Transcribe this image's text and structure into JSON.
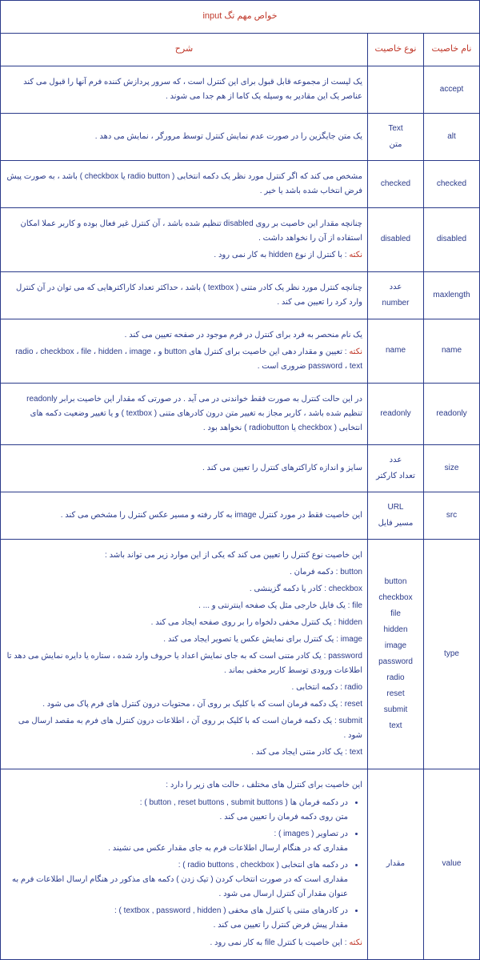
{
  "title": "خواص مهم تگ input",
  "headers": {
    "name": "نام خاصیت",
    "type": "نوع خاصیت",
    "desc": "شرح"
  },
  "rows": [
    {
      "name": "accept",
      "type": [
        ""
      ],
      "desc": "<p>یک لیست از مجموعه قابل قبول برای این کنترل است ، که سرور پردازش کننده فرم آنها را قبول می کند عناصر یک این مقادیر به وسیله یک کاما از هم جدا می شوند .</p>"
    },
    {
      "name": "alt",
      "type": [
        "Text",
        "متن"
      ],
      "desc": "<p>یک متن جایگزین را در صورت عدم نمایش کنترل توسط مرورگر ، نمایش می دهد .</p>"
    },
    {
      "name": "checked",
      "type": [
        "checked"
      ],
      "desc": "<p>مشخص می کند که اگر کنترل مورد نظر یک دکمه انتخابی ( radio button یا checkbox ) باشد ، به صورت پیش فرض انتخاب شده باشد یا خیر .</p>"
    },
    {
      "name": "disabled",
      "type": [
        "disabled"
      ],
      "desc": "<p>چنانچه مقدار این خاصیت بر روی disabled تنظیم شده باشد ، آن کنترل غیر فعال بوده و کاربر عملا امکان استفاده از آن را نخواهد داشت .</p><p><span class=\"red\">نکته</span> : با کنترل از نوع hidden به کار نمی رود .</p>"
    },
    {
      "name": "maxlength",
      "type": [
        "عدد",
        "number"
      ],
      "desc": "<p>چنانچه کنترل مورد نظر یک کادر متنی ( textbox ) باشد ، حداکثر تعداد کاراکترهایی که می توان در آن کنترل وارد کرد را تعیین می کند .</p>"
    },
    {
      "name": "name",
      "type": [
        "name"
      ],
      "desc": "<p>یک نام منحصر به فرد برای کنترل در فرم موجود در صفحه تعیین می کند .</p><p><span class=\"red\">نکته</span> : تعیین و مقدار دهی این خاصیت برای کنترل های button و radio ، checkbox ، file ، hidden ، image ، password ، text ضروری است .</p>"
    },
    {
      "name": "readonly",
      "type": [
        "readonly"
      ],
      "desc": "<p>در این حالت کنترل به صورت فقط خواندنی در می آید . در صورتی که مقدار این خاصیت برابر readonly تنظیم شده باشد ، کاربر مجاز به تغییر متن درون کادرهای متنی ( textbox ) و یا تغییر وضعیت دکمه های انتخابی ( checkbox یا radiobutton ) نخواهد بود .</p>"
    },
    {
      "name": "size",
      "type": [
        "عدد",
        "تعداد کارکتر"
      ],
      "desc": "<p>سایز و اندازه کاراکترهای کنترل را تعیین می کند .</p>"
    },
    {
      "name": "src",
      "type": [
        "URL",
        "مسیر فایل"
      ],
      "desc": "<p>این خاصیت فقط در مورد کنترل image به کار رفته و مسیر عکس کنترل را مشخص می کند .</p>"
    },
    {
      "name": "type",
      "type": [
        "button",
        "checkbox",
        "file",
        "hidden",
        "image",
        "password",
        "radio",
        "reset",
        "submit",
        "text"
      ],
      "desc": "<p>این خاصیت نوع کنترل را تعیین می کند که یکی از این موارد زیر می تواند باشد :</p><p>button : دکمه فرمان .</p><p>checkbox : کادر یا دکمه گزینشی .</p><p>file : یک فایل خارجی مثل یک صفحه اینترنتی و ... .</p><p>hidden : یک کنترل مخفی دلخواه را بر روی صفحه ایجاد می کند .</p><p>image : یک کنترل برای نمایش عکس یا تصویر ایجاد می کند .</p><p>password : یک کادر متنی است که به جای نمایش اعداد یا حروف وارد شده ، ستاره یا دایره نمایش می دهد تا اطلاعات ورودی توسط کاربر مخفی بماند .</p><p>radio : دکمه انتخابی .</p><p>reset : یک دکمه فرمان است که با کلیک بر روی آن ، محتویات درون کنترل های فرم پاک می شود .</p><p>submit : یک دکمه فرمان است که با کلیک بر روی آن ، اطلاعات درون کنترل های فرم به مقصد ارسال می شود .</p><p>text : یک کادر متنی ایجاد می کند .</p>"
    },
    {
      "name": "value",
      "type": [
        "مقدار"
      ],
      "desc": "<p>این خاصیت برای کنترل های مختلف ، حالت های زیر را دارد :</p><ul><li>در دکمه فرمان ها ( button , reset buttons , submit buttons ) :<br>متن روی دکمه فرمان را تعیین می کند .</li><li>در تصاویر ( images ) :<br>مقداری که در هنگام ارسال اطلاعات فرم به جای مقدار عکس می نشیند .</li><li>در دکمه های انتخابی ( radio buttons , checkbox ) :<br>مقداری است که در صورت انتخاب کردن ( تیک زدن ) دکمه های مذکور در هنگام ارسال اطلاعات فرم به عنوان مقدار آن کنترل ارسال می شود .</li><li>در کادرهای متنی یا کنترل های مخفی ( textbox , password , hidden ) :<br>مقدار پیش فرض کنترل را تعیین می کند .</li></ul><p><span class=\"red\">نکته</span> : این خاصیت با کنترل file به کار نمی رود .</p>"
    }
  ]
}
